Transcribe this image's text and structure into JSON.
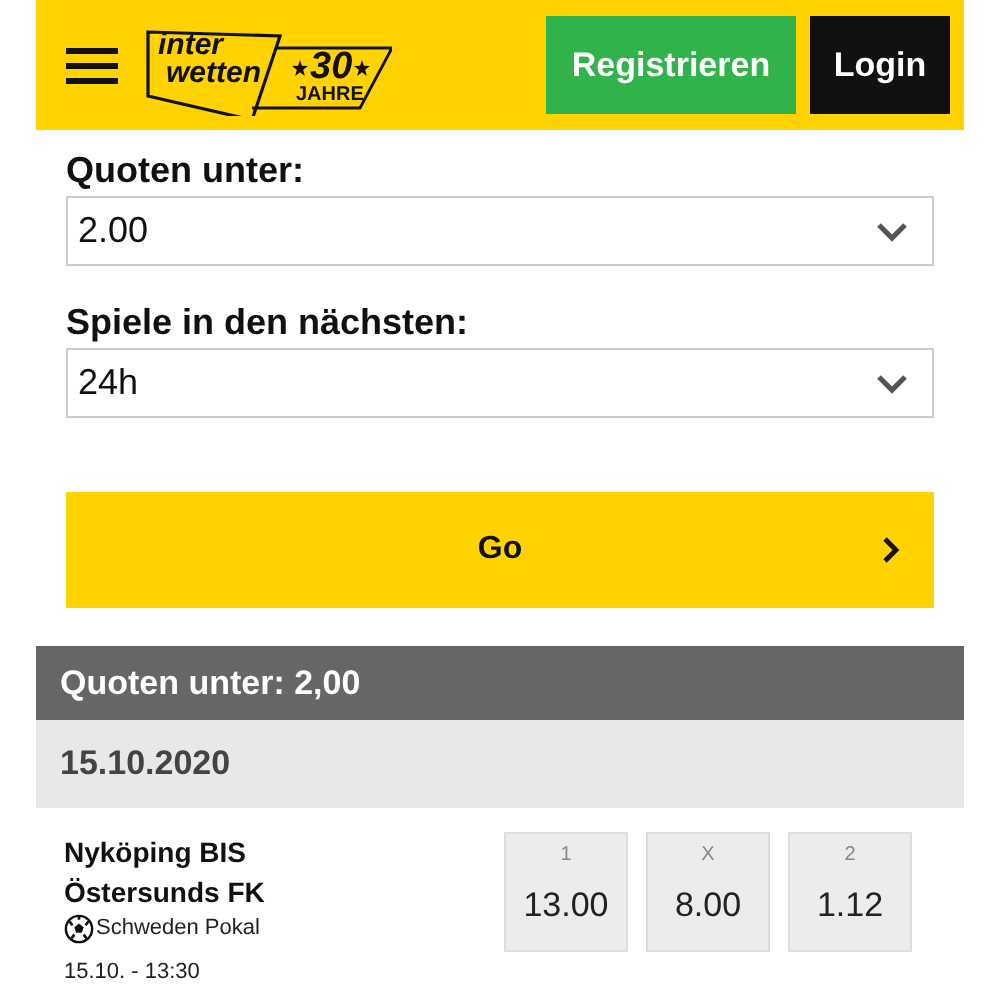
{
  "header": {
    "logo": {
      "line_1": "inter",
      "line_2": "wetten",
      "anniversary": "30",
      "anniversary_label": "JAHRE"
    },
    "register_button": "Registrieren",
    "login_button": "Login"
  },
  "filters": [
    {
      "label": "Quoten unter:",
      "value": "2.00"
    },
    {
      "label": "Spiele in den nächsten:",
      "value": "24h"
    }
  ],
  "go_button": "Go",
  "results_header": "Quoten unter: 2,00",
  "date_header": "15.10.2020",
  "matches": [
    {
      "home": "Nyköping BIS",
      "away": "Östersunds FK",
      "competition": "Schweden Pokal",
      "time": "15.10. - 13:30",
      "odds": [
        {
          "label": "1",
          "value": "13.00"
        },
        {
          "label": "X",
          "value": "8.00"
        },
        {
          "label": "2",
          "value": "1.12"
        }
      ]
    }
  ]
}
